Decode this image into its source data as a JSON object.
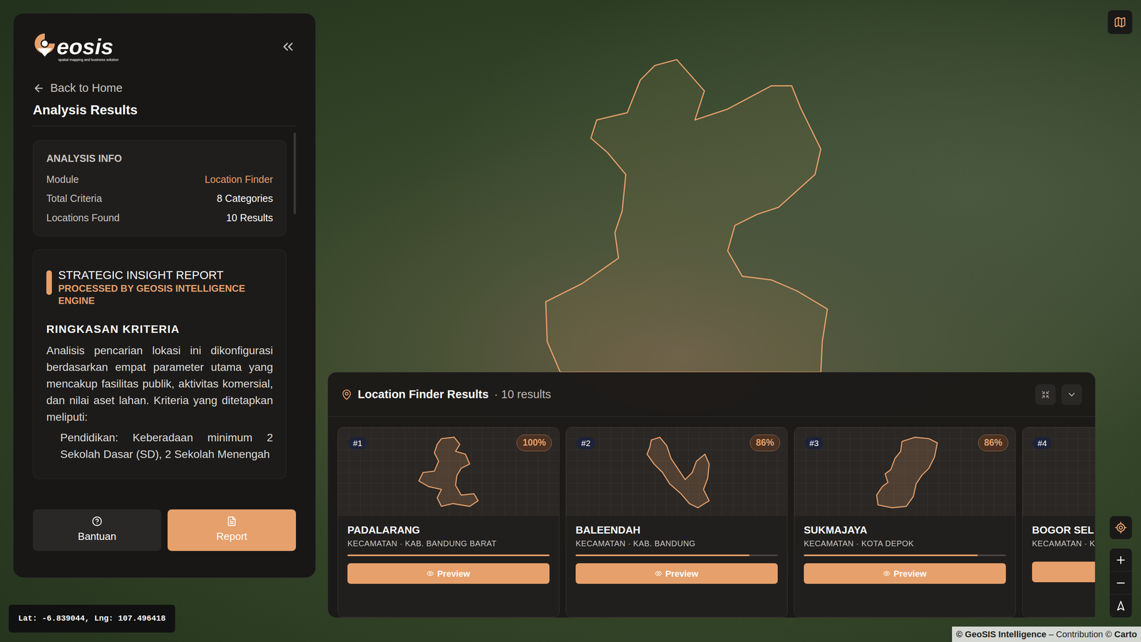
{
  "app": {
    "logo": "eosis",
    "tagline": "spatial mapping and business solution"
  },
  "sidebar": {
    "back": "Back to Home",
    "title": "Analysis Results",
    "info": {
      "title": "ANALYSIS INFO",
      "rows": [
        {
          "label": "Module",
          "value": "Location Finder",
          "highlight": true
        },
        {
          "label": "Total Criteria",
          "value": "8 Categories",
          "highlight": false
        },
        {
          "label": "Locations Found",
          "value": "10 Results",
          "highlight": false
        }
      ]
    },
    "report": {
      "title": "STRATEGIC INSIGHT REPORT",
      "subtitle": "PROCESSED BY GEOSIS INTELLIGENCE ENGINE",
      "heading": "RINGKASAN KRITERIA",
      "paragraph": "Analisis pencarian lokasi ini dikonfigurasi berdasarkan empat parameter utama yang mencakup fasilitas publik, aktivitas komersial, dan nilai aset lahan. Kriteria yang ditetapkan meliputi:",
      "items": [
        "Pendidikan: Keberadaan minimum 2 Sekolah Dasar (SD), 2 Sekolah Menengah"
      ]
    },
    "buttons": [
      {
        "label": "Bantuan",
        "primary": false
      },
      {
        "label": "Report",
        "primary": true
      }
    ]
  },
  "results": {
    "title": "Location Finder Results",
    "count": "· 10 results",
    "cards": [
      {
        "rank": "#1",
        "score": "100%",
        "name": "PADALARANG",
        "subtitle": "KECAMATAN · KAB. BANDUNG BARAT",
        "level": 1.0,
        "button": "Preview"
      },
      {
        "rank": "#2",
        "score": "86%",
        "name": "BALEENDAH",
        "subtitle": "KECAMATAN · KAB. BANDUNG",
        "level": 0.86,
        "button": "Preview"
      },
      {
        "rank": "#3",
        "score": "86%",
        "name": "SUKMAJAYA",
        "subtitle": "KECAMATAN · KOTA DEPOK",
        "level": 0.86,
        "button": "Preview"
      },
      {
        "rank": "#4",
        "name": "BOGOR SEL",
        "subtitle": "KECAMATAN · K"
      }
    ]
  },
  "coordinates": "Lat: -6.839044, Lng: 107.496418",
  "attribution": [
    {
      "text": "© GeoSIS Intelligence",
      "bold": true
    },
    {
      "text": " – Contribution © ",
      "bold": false
    },
    {
      "text": "Carto",
      "bold": true
    }
  ]
}
